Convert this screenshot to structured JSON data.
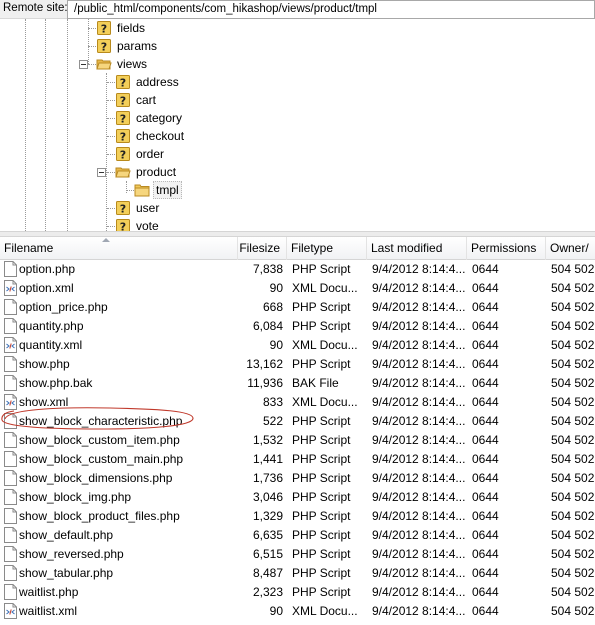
{
  "remote_site": {
    "label": "Remote site:",
    "path": "/public_html/components/com_hikashop/views/product/tmpl"
  },
  "tree": [
    {
      "label": "fields",
      "icon": "question-folder-icon"
    },
    {
      "label": "params",
      "icon": "question-folder-icon"
    },
    {
      "label": "views",
      "icon": "folder-open-icon",
      "expanded": true
    },
    {
      "label": "address",
      "icon": "question-folder-icon"
    },
    {
      "label": "cart",
      "icon": "question-folder-icon"
    },
    {
      "label": "category",
      "icon": "question-folder-icon"
    },
    {
      "label": "checkout",
      "icon": "question-folder-icon"
    },
    {
      "label": "order",
      "icon": "question-folder-icon"
    },
    {
      "label": "product",
      "icon": "folder-open-icon",
      "expanded": true
    },
    {
      "label": "tmpl",
      "icon": "folder-icon",
      "selected": true
    },
    {
      "label": "user",
      "icon": "question-folder-icon"
    },
    {
      "label": "vote",
      "icon": "question-folder-icon"
    }
  ],
  "columns": {
    "filename": "Filename",
    "filesize": "Filesize",
    "filetype": "Filetype",
    "last_modified": "Last modified",
    "permissions": "Permissions",
    "owner": "Owner/"
  },
  "files": [
    {
      "name": "option.php",
      "size": "7,838",
      "type": "PHP Script",
      "modified": "9/4/2012 8:14:4...",
      "perm": "0644",
      "owner": "504 502",
      "icon": "php-file-icon"
    },
    {
      "name": "option.xml",
      "size": "90",
      "type": "XML Docu...",
      "modified": "9/4/2012 8:14:4...",
      "perm": "0644",
      "owner": "504 502",
      "icon": "xml-file-icon"
    },
    {
      "name": "option_price.php",
      "size": "668",
      "type": "PHP Script",
      "modified": "9/4/2012 8:14:4...",
      "perm": "0644",
      "owner": "504 502",
      "icon": "php-file-icon"
    },
    {
      "name": "quantity.php",
      "size": "6,084",
      "type": "PHP Script",
      "modified": "9/4/2012 8:14:4...",
      "perm": "0644",
      "owner": "504 502",
      "icon": "php-file-icon"
    },
    {
      "name": "quantity.xml",
      "size": "90",
      "type": "XML Docu...",
      "modified": "9/4/2012 8:14:4...",
      "perm": "0644",
      "owner": "504 502",
      "icon": "xml-file-icon"
    },
    {
      "name": "show.php",
      "size": "13,162",
      "type": "PHP Script",
      "modified": "9/4/2012 8:14:4...",
      "perm": "0644",
      "owner": "504 502",
      "icon": "php-file-icon"
    },
    {
      "name": "show.php.bak",
      "size": "11,936",
      "type": "BAK File",
      "modified": "9/4/2012 8:14:4...",
      "perm": "0644",
      "owner": "504 502",
      "icon": "bak-file-icon"
    },
    {
      "name": "show.xml",
      "size": "833",
      "type": "XML Docu...",
      "modified": "9/4/2012 8:14:4...",
      "perm": "0644",
      "owner": "504 502",
      "icon": "xml-file-icon"
    },
    {
      "name": "show_block_characteristic.php",
      "size": "522",
      "type": "PHP Script",
      "modified": "9/4/2012 8:14:4...",
      "perm": "0644",
      "owner": "504 502",
      "icon": "php-file-icon",
      "circled": true
    },
    {
      "name": "show_block_custom_item.php",
      "size": "1,532",
      "type": "PHP Script",
      "modified": "9/4/2012 8:14:4...",
      "perm": "0644",
      "owner": "504 502",
      "icon": "php-file-icon"
    },
    {
      "name": "show_block_custom_main.php",
      "size": "1,441",
      "type": "PHP Script",
      "modified": "9/4/2012 8:14:4...",
      "perm": "0644",
      "owner": "504 502",
      "icon": "php-file-icon"
    },
    {
      "name": "show_block_dimensions.php",
      "size": "1,736",
      "type": "PHP Script",
      "modified": "9/4/2012 8:14:4...",
      "perm": "0644",
      "owner": "504 502",
      "icon": "php-file-icon"
    },
    {
      "name": "show_block_img.php",
      "size": "3,046",
      "type": "PHP Script",
      "modified": "9/4/2012 8:14:4...",
      "perm": "0644",
      "owner": "504 502",
      "icon": "php-file-icon"
    },
    {
      "name": "show_block_product_files.php",
      "size": "1,329",
      "type": "PHP Script",
      "modified": "9/4/2012 8:14:4...",
      "perm": "0644",
      "owner": "504 502",
      "icon": "php-file-icon"
    },
    {
      "name": "show_default.php",
      "size": "6,635",
      "type": "PHP Script",
      "modified": "9/4/2012 8:14:4...",
      "perm": "0644",
      "owner": "504 502",
      "icon": "php-file-icon"
    },
    {
      "name": "show_reversed.php",
      "size": "6,515",
      "type": "PHP Script",
      "modified": "9/4/2012 8:14:4...",
      "perm": "0644",
      "owner": "504 502",
      "icon": "php-file-icon"
    },
    {
      "name": "show_tabular.php",
      "size": "8,487",
      "type": "PHP Script",
      "modified": "9/4/2012 8:14:4...",
      "perm": "0644",
      "owner": "504 502",
      "icon": "php-file-icon"
    },
    {
      "name": "waitlist.php",
      "size": "2,323",
      "type": "PHP Script",
      "modified": "9/4/2012 8:14:4...",
      "perm": "0644",
      "owner": "504 502",
      "icon": "php-file-icon"
    },
    {
      "name": "waitlist.xml",
      "size": "90",
      "type": "XML Docu...",
      "modified": "9/4/2012 8:14:4...",
      "perm": "0644",
      "owner": "504 502",
      "icon": "xml-file-icon"
    }
  ],
  "colors": {
    "annotation": "#c0392b",
    "folder": "#e8b84a",
    "question": "#222222"
  }
}
